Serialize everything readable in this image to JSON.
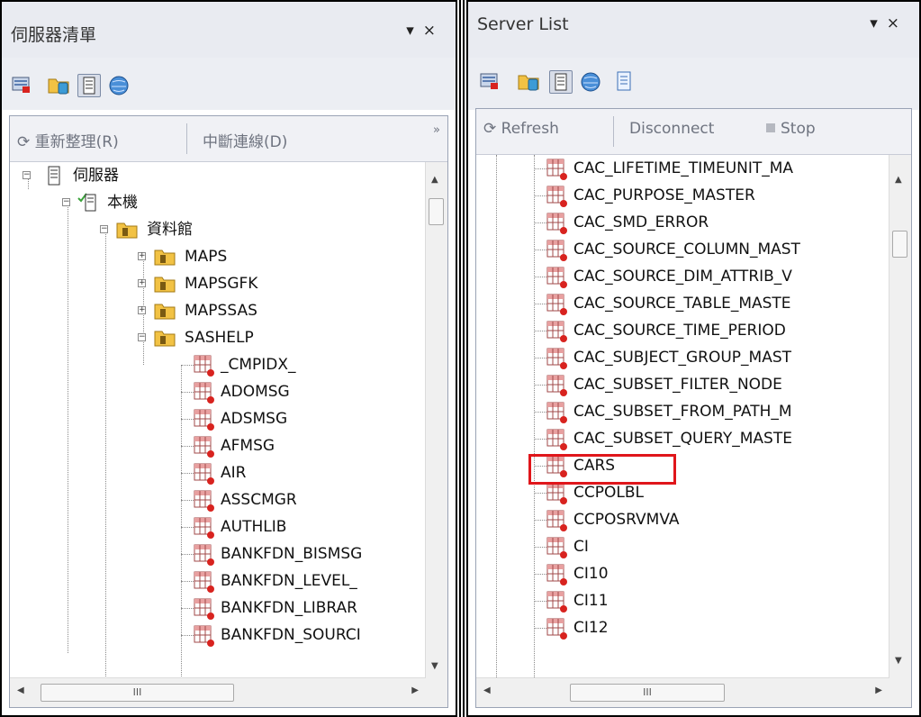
{
  "colors": {
    "highlight": "#e0161b",
    "table_icon_red": "#d8231f",
    "folder_gold": "#d9a21b"
  },
  "left_panel": {
    "title": "伺服器清單",
    "controls": {
      "pin": "▾",
      "close": "×"
    },
    "toolbar_icons": [
      "server-icon",
      "library-icon",
      "list-view-icon",
      "globe-icon"
    ],
    "actions": {
      "refresh": "重新整理(R)",
      "disconnect": "中斷連線(D)"
    },
    "chevron": "»",
    "tree": {
      "root": "伺服器",
      "local": "本機",
      "libraries_folder": "資料館",
      "libraries": [
        "MAPS",
        "MAPSGFK",
        "MAPSSAS",
        "SASHELP"
      ],
      "tables": [
        "_CMPIDX_",
        "ADOMSG",
        "ADSMSG",
        "AFMSG",
        "AIR",
        "ASSCMGR",
        "AUTHLIB",
        "BANKFDN_BISMSG",
        "BANKFDN_LEVEL_",
        "BANKFDN_LIBRAR",
        "BANKFDN_SOURCI"
      ]
    },
    "scroll_mark": "III"
  },
  "right_panel": {
    "title": "Server List",
    "controls": {
      "pin": "▾",
      "close": "×"
    },
    "toolbar_icons": [
      "server-icon",
      "library-icon",
      "list-view-icon",
      "globe-icon",
      "document-icon"
    ],
    "actions": {
      "refresh": "Refresh",
      "disconnect": "Disconnect",
      "stop": "Stop"
    },
    "tables": [
      "CAC_LIFETIME_TIMEUNIT_MA",
      "CAC_PURPOSE_MASTER",
      "CAC_SMD_ERROR",
      "CAC_SOURCE_COLUMN_MAST",
      "CAC_SOURCE_DIM_ATTRIB_V",
      "CAC_SOURCE_TABLE_MASTE",
      "CAC_SOURCE_TIME_PERIOD",
      "CAC_SUBJECT_GROUP_MAST",
      "CAC_SUBSET_FILTER_NODE",
      "CAC_SUBSET_FROM_PATH_M",
      "CAC_SUBSET_QUERY_MASTE",
      "CARS",
      "CCPOLBL",
      "CCPOSRVMVA",
      "CI",
      "CI10",
      "CI11",
      "CI12"
    ],
    "highlighted": "CARS",
    "scroll_mark": "III"
  }
}
